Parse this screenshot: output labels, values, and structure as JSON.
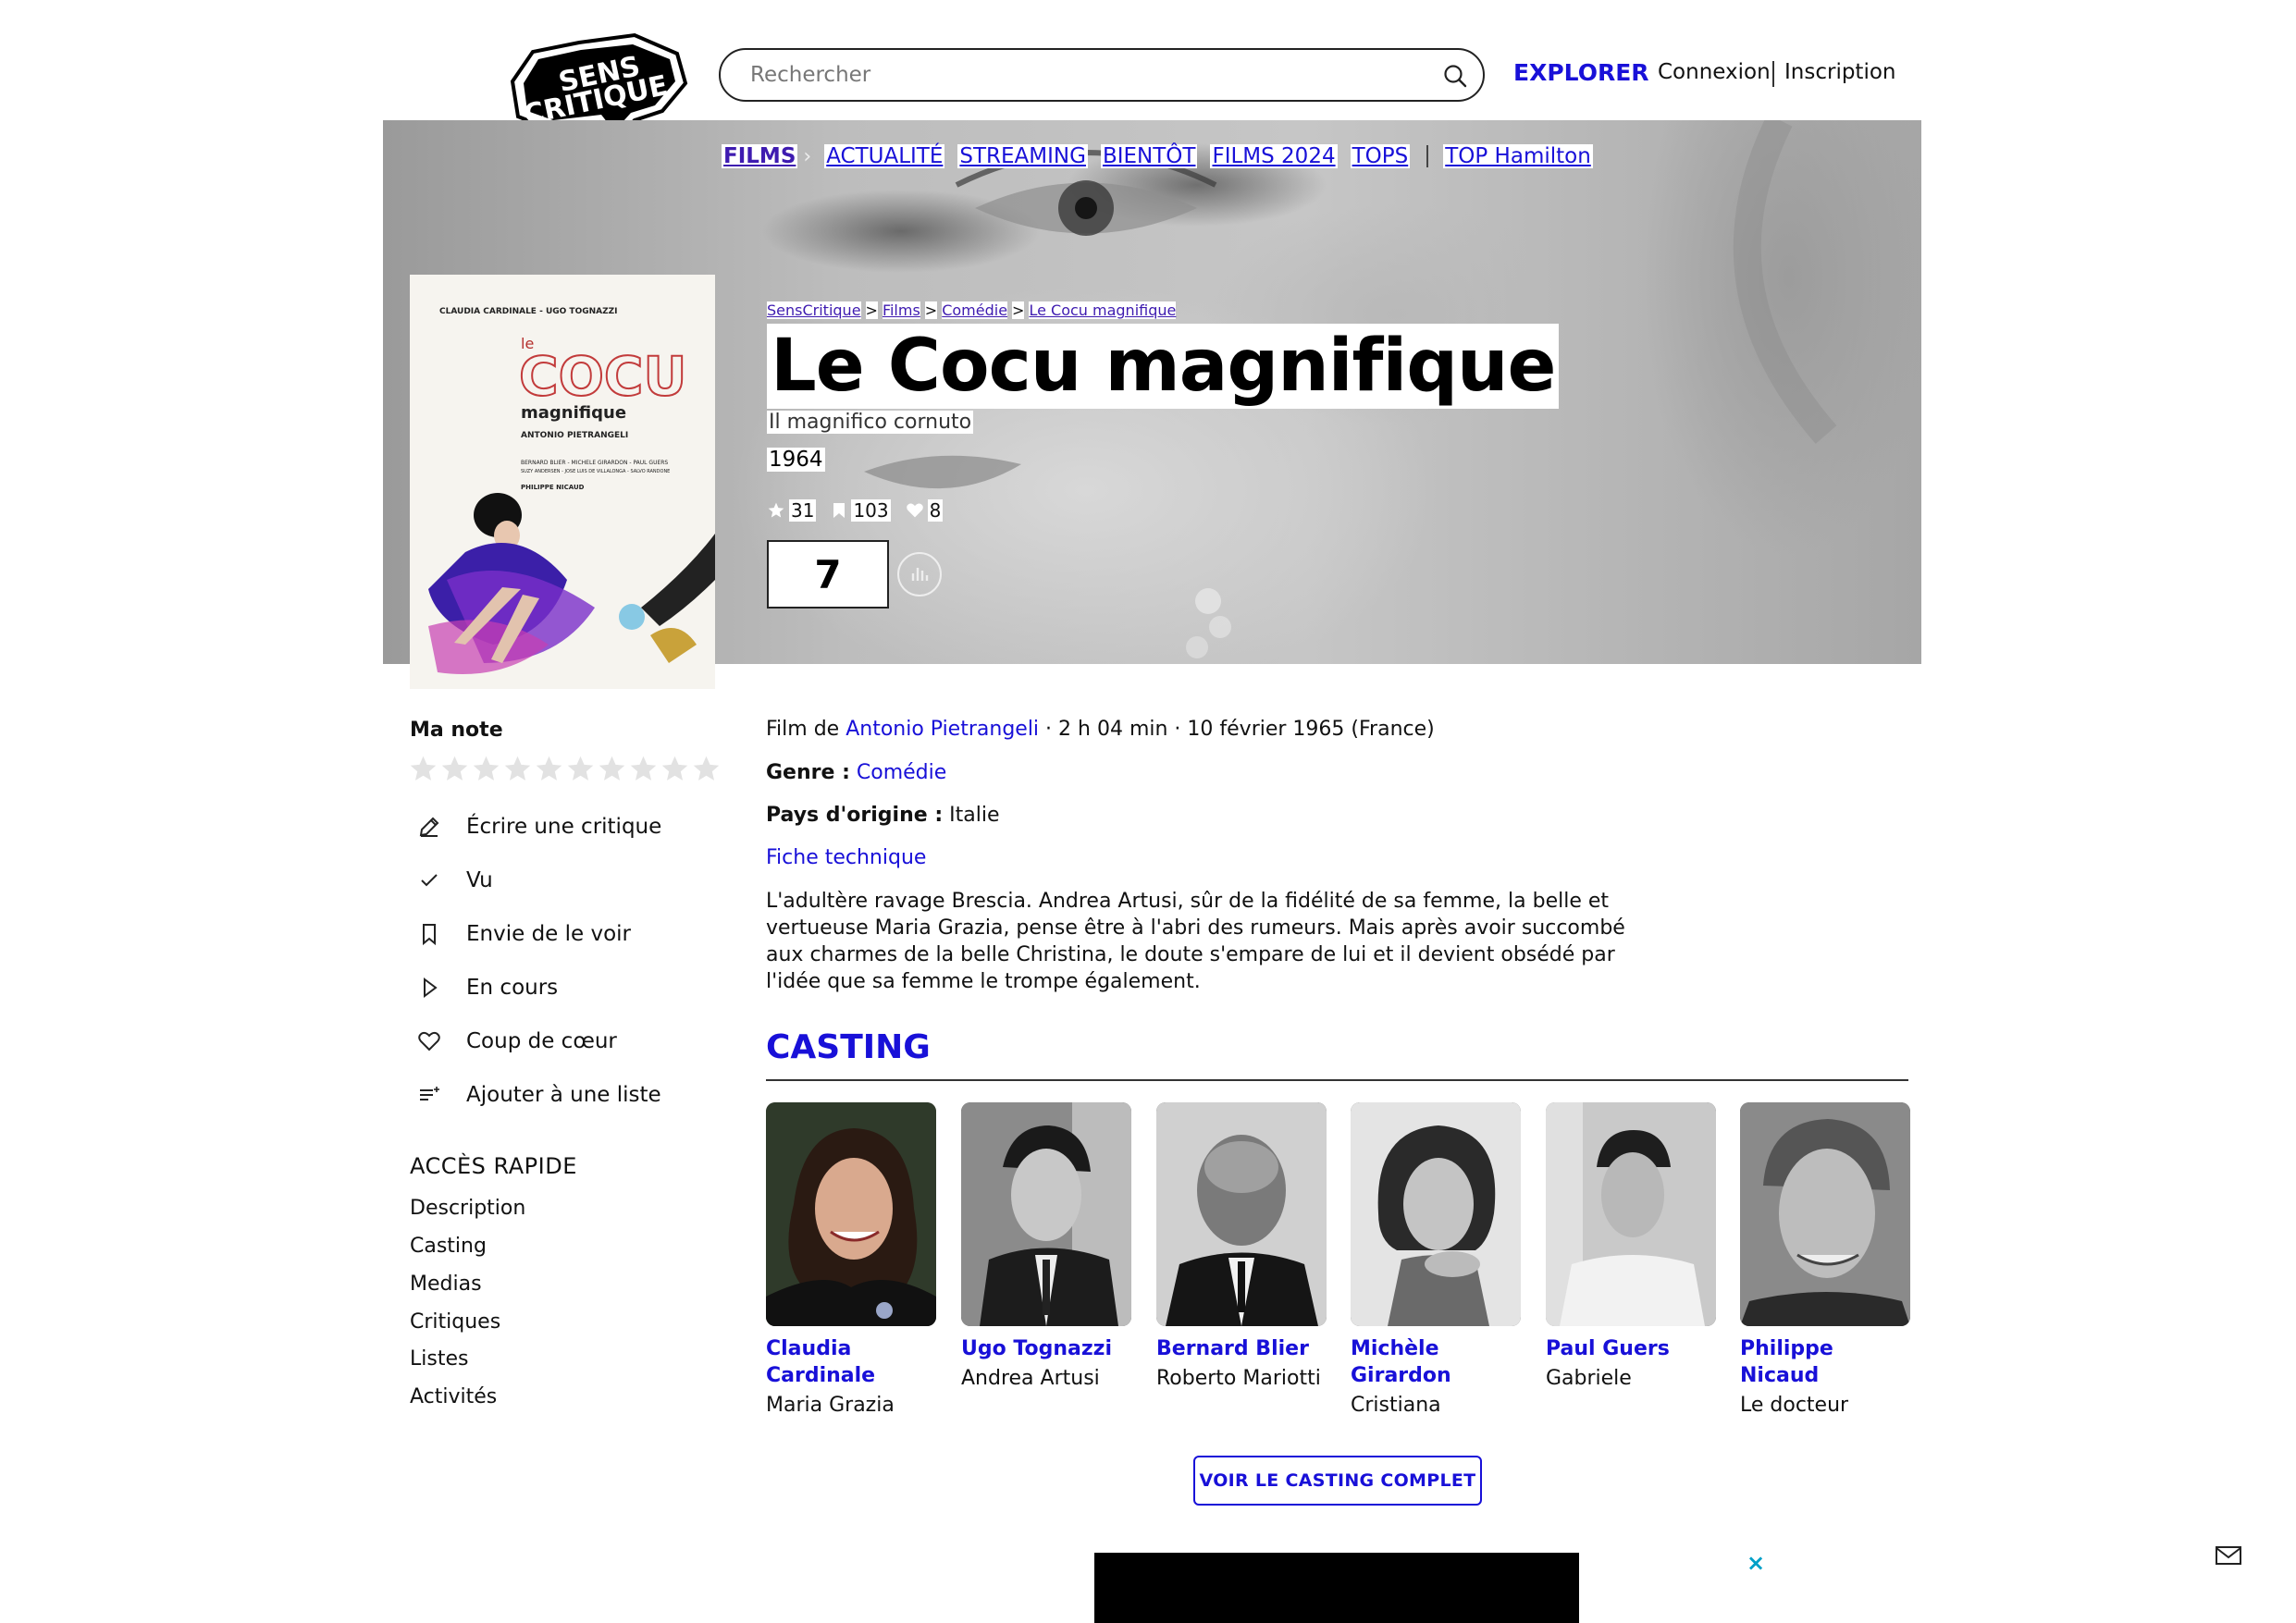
{
  "header": {
    "logo_text": "SENS CRITIQUE",
    "search_placeholder": "Rechercher",
    "explorer": "EXPLORER",
    "connexion": "Connexion",
    "inscription": "Inscription"
  },
  "nav": {
    "active": "FILMS",
    "items": [
      "ACTUALITÉ",
      "STREAMING",
      "BIENTÔT",
      "FILMS 2024",
      "TOPS"
    ],
    "extra": "TOP Hamilton"
  },
  "breadcrumb": [
    "SensCritique",
    "Films",
    "Comédie",
    "Le Cocu magnifique"
  ],
  "movie": {
    "title": "Le Cocu magnifique",
    "original_title": "Il magnifico cornuto",
    "year": "1964",
    "stats": {
      "ratings": "31",
      "wishlist": "103",
      "favorites": "8"
    },
    "rating": "7"
  },
  "poster": {
    "credits_top": "CLAUDIA CARDINALE - UGO TOGNAZZI",
    "title_le": "le",
    "title_main": "COCU",
    "title_sub": "magnifique",
    "director": "ANTONIO PIETRANGELI",
    "cast_line1": "BERNARD BLIER - MICHELE GIRARDON - PAUL GUERS",
    "cast_line2": "SUZY ANDERSEN - JOSE LUIS DE VILLALONGA - SALVO RANDONE",
    "producer": "PHILIPPE NICAUD"
  },
  "sidebar": {
    "my_rating_label": "Ma note",
    "star_count": 10,
    "actions": [
      {
        "label": "Écrire une critique",
        "icon": "pencil-icon"
      },
      {
        "label": "Vu",
        "icon": "check-icon"
      },
      {
        "label": "Envie de le voir",
        "icon": "bookmark-icon"
      },
      {
        "label": "En cours",
        "icon": "play-icon"
      },
      {
        "label": "Coup de cœur",
        "icon": "heart-icon"
      },
      {
        "label": "Ajouter à une liste",
        "icon": "list-add-icon"
      }
    ],
    "quick_access_title": "ACCÈS RAPIDE",
    "quick_access": [
      "Description",
      "Casting",
      "Medias",
      "Critiques",
      "Listes",
      "Activités"
    ]
  },
  "details": {
    "film_de_prefix": "Film de",
    "director": "Antonio Pietrangeli",
    "meta": "· 2 h 04 min · 10 février 1965 (France)",
    "genre_label": "Genre :",
    "genre": "Comédie",
    "country_label": "Pays d'origine :",
    "country": "Italie",
    "fiche": "Fiche technique",
    "synopsis": "L'adultère ravage Brescia. Andrea Artusi, sûr de la fidélité de sa femme, la belle et vertueuse Maria Grazia, pense être à l'abri des rumeurs. Mais après avoir succombé aux charmes de la belle Christina, le doute s'empare de lui et il devient obsédé par l'idée que sa femme le trompe également."
  },
  "casting": {
    "title": "CASTING",
    "members": [
      {
        "name": "Claudia Cardinale",
        "role": "Maria Grazia"
      },
      {
        "name": "Ugo Tognazzi",
        "role": "Andrea Artusi"
      },
      {
        "name": "Bernard Blier",
        "role": "Roberto Mariotti"
      },
      {
        "name": "Michèle Girardon",
        "role": "Cristiana"
      },
      {
        "name": "Paul Guers",
        "role": "Gabriele"
      },
      {
        "name": "Philippe Nicaud",
        "role": "Le docteur"
      }
    ],
    "full_casting": "VOIR LE CASTING COMPLET"
  },
  "ad": {
    "close": "×"
  },
  "colors": {
    "accent": "#1810d8",
    "active_nav": "#3e1bb0",
    "ad_close": "#00a0c8"
  }
}
